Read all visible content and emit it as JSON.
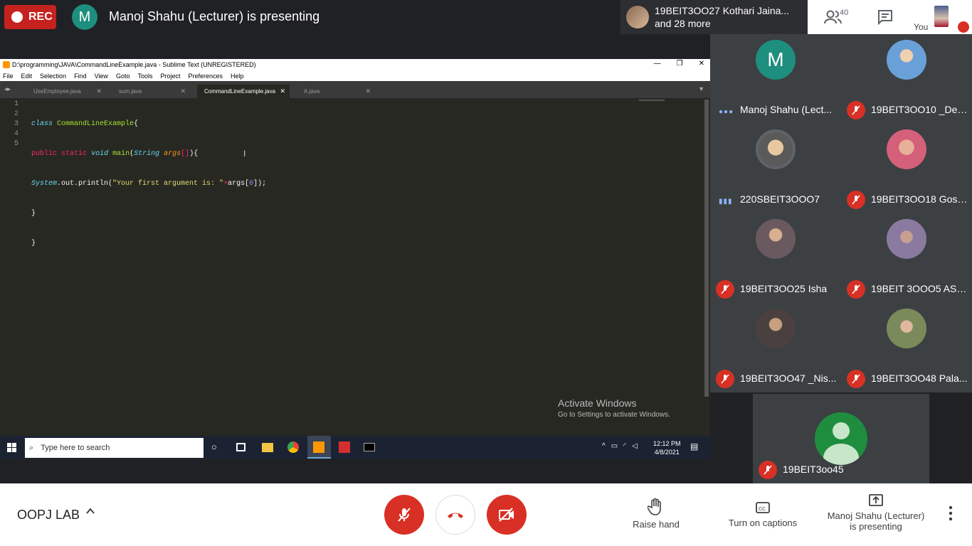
{
  "top_bar": {
    "rec_label": "REC",
    "presenter_initial": "M",
    "presenting_text": "Manoj Shahu (Lecturer) is presenting",
    "joined_line1": "19BEIT3OO27 Kothari Jaina...",
    "joined_line2": "and 28 more",
    "people_count": "40",
    "you_label": "You"
  },
  "sublime": {
    "window_title": "D:\\programming\\JAVA\\CommandLineExample.java - Sublime Text (UNREGISTERED)",
    "menu": [
      "File",
      "Edit",
      "Selection",
      "Find",
      "View",
      "Goto",
      "Tools",
      "Project",
      "Preferences",
      "Help"
    ],
    "tabs": [
      "UseEmployee.java",
      "sum.java",
      "CommandLineExample.java",
      "A.java"
    ],
    "line_numbers": [
      "1",
      "2",
      "3",
      "4",
      "5"
    ],
    "activate_title": "Activate Windows",
    "activate_sub": "Go to Settings to activate Windows.",
    "taskbar_search": "Type here to search",
    "time": "12:12 PM",
    "date": "4/8/2021"
  },
  "participants": [
    {
      "name": "Manoj Shahu (Lect...",
      "initial": "M",
      "avatar_color": "#1e8e7e",
      "status": "speaking"
    },
    {
      "name": "19BEIT3OO10 _Dee...",
      "avatar_color": "#6aa0d8",
      "status": "muted"
    },
    {
      "name": "220SBEIT3OOO7",
      "avatar_color": "#c9a27a",
      "status": "speaking"
    },
    {
      "name": "19BEIT3OO18 Gosa...",
      "avatar_color": "#d4607a",
      "status": "muted"
    },
    {
      "name": "19BEIT3OO25 Isha",
      "avatar_color": "#6a5a60",
      "status": "muted"
    },
    {
      "name": "19BEIT 3OOO5 ASH...",
      "avatar_color": "#8a7aa0",
      "status": "muted"
    },
    {
      "name": "19BEIT3OO47 _Nis...",
      "avatar_color": "#4a4040",
      "status": "muted"
    },
    {
      "name": "19BEIT3OO48 Pala...",
      "avatar_color": "#7a8a5a",
      "status": "muted"
    },
    {
      "name": "19BEIT3oo45",
      "avatar_color": "#1e8e3e",
      "status": "muted"
    }
  ],
  "bottom_bar": {
    "meeting_name": "OOPJ LAB",
    "raise_hand": "Raise hand",
    "captions": "Turn on captions",
    "present_line1": "Manoj Shahu (Lecturer)",
    "present_line2": "is presenting"
  },
  "colors": {
    "accent_red": "#d93025",
    "meet_green": "#1e8e3e",
    "editor_bg": "#272822"
  }
}
